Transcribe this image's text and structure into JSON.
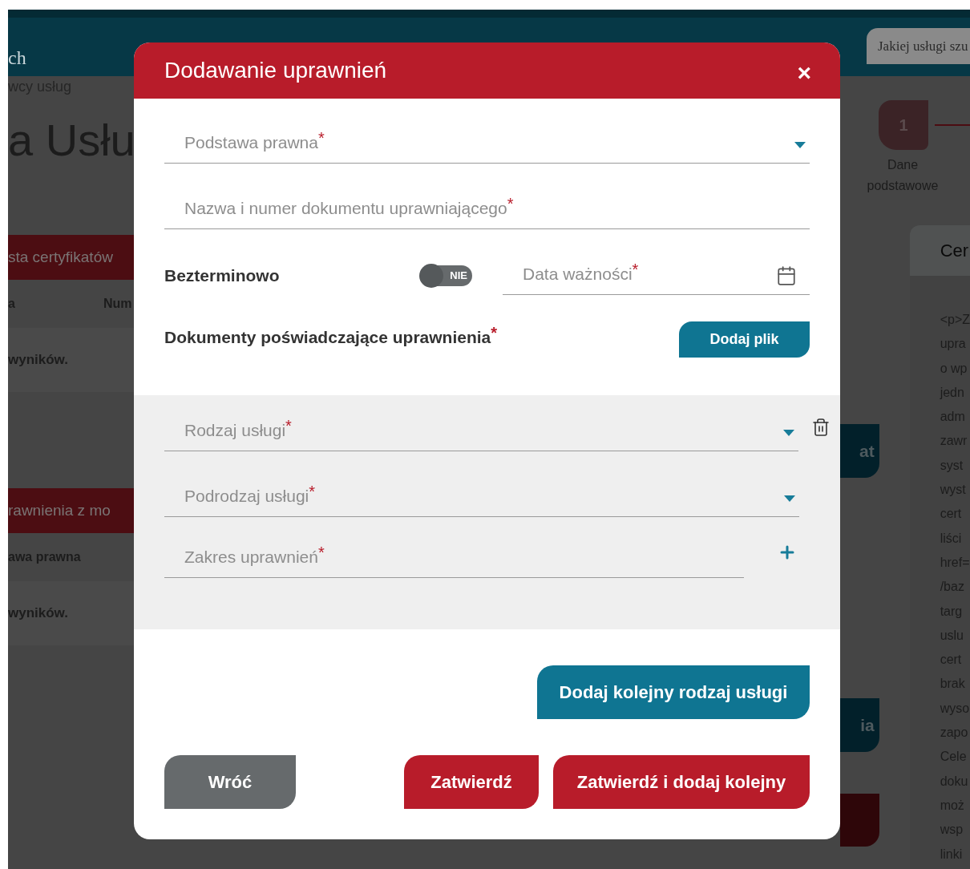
{
  "header": {
    "brand_fragment": "ch",
    "search": {
      "placeholder": "Jakiej usługi szu"
    }
  },
  "background": {
    "breadcrumb": "wcy usług",
    "title": "a Usłu",
    "sections": [
      {
        "title": "sta certyfikatów",
        "columns": [
          "a",
          "Num"
        ],
        "empty_text": "wyników."
      },
      {
        "title": "rawnienia z mo",
        "columns": [
          "awa prawna"
        ],
        "empty_text": "wyników."
      }
    ],
    "stepper": [
      {
        "number": "1",
        "label": "Dane podstawowe"
      }
    ],
    "side_buttons": [
      "at",
      "ia"
    ],
    "info_card": {
      "title": "Cer",
      "lines": [
        "<p>Z",
        "upra",
        "o wp",
        "jedn",
        "adm",
        "zawr",
        "syst",
        "wyst",
        "cert",
        "liści",
        "href=",
        "/baz",
        "targ",
        "uslu",
        "cert",
        "brak",
        "wyso",
        "zapo",
        "Cele",
        "doku",
        "moż",
        "wsp",
        "linki"
      ]
    }
  },
  "dialog": {
    "title": "Dodawanie uprawnień",
    "close": "×",
    "fields": [
      {
        "kind": "select",
        "label": "Podstawa prawna",
        "mark": "*"
      },
      {
        "kind": "text",
        "label": "Nazwa i numer dokumentu uprawniającego",
        "mark": "*"
      }
    ],
    "validity": {
      "label": "Bezterminowo",
      "toggle": {
        "on": false,
        "text": "NIE"
      },
      "date": {
        "label": "Data ważności",
        "mark": "*"
      }
    },
    "documents": {
      "label": "Dokumenty poświadczające uprawnienia",
      "mark": "*",
      "button": "Dodaj plik"
    },
    "service": {
      "fields": [
        {
          "kind": "select",
          "label": "Rodzaj usługi",
          "mark": "*"
        },
        {
          "kind": "select",
          "label": "Podrodzaj usługi",
          "mark": "*"
        },
        {
          "kind": "text",
          "label": "Zakres uprawnień",
          "mark": "*"
        }
      ]
    },
    "add_service_button": "Dodaj kolejny rodzaj usługi",
    "buttons": [
      {
        "kind": "secondary",
        "label": "Wróć"
      },
      {
        "kind": "primary",
        "label": "Zatwierdź"
      },
      {
        "kind": "primary",
        "label": "Zatwierdź i dodaj kolejny"
      }
    ]
  }
}
